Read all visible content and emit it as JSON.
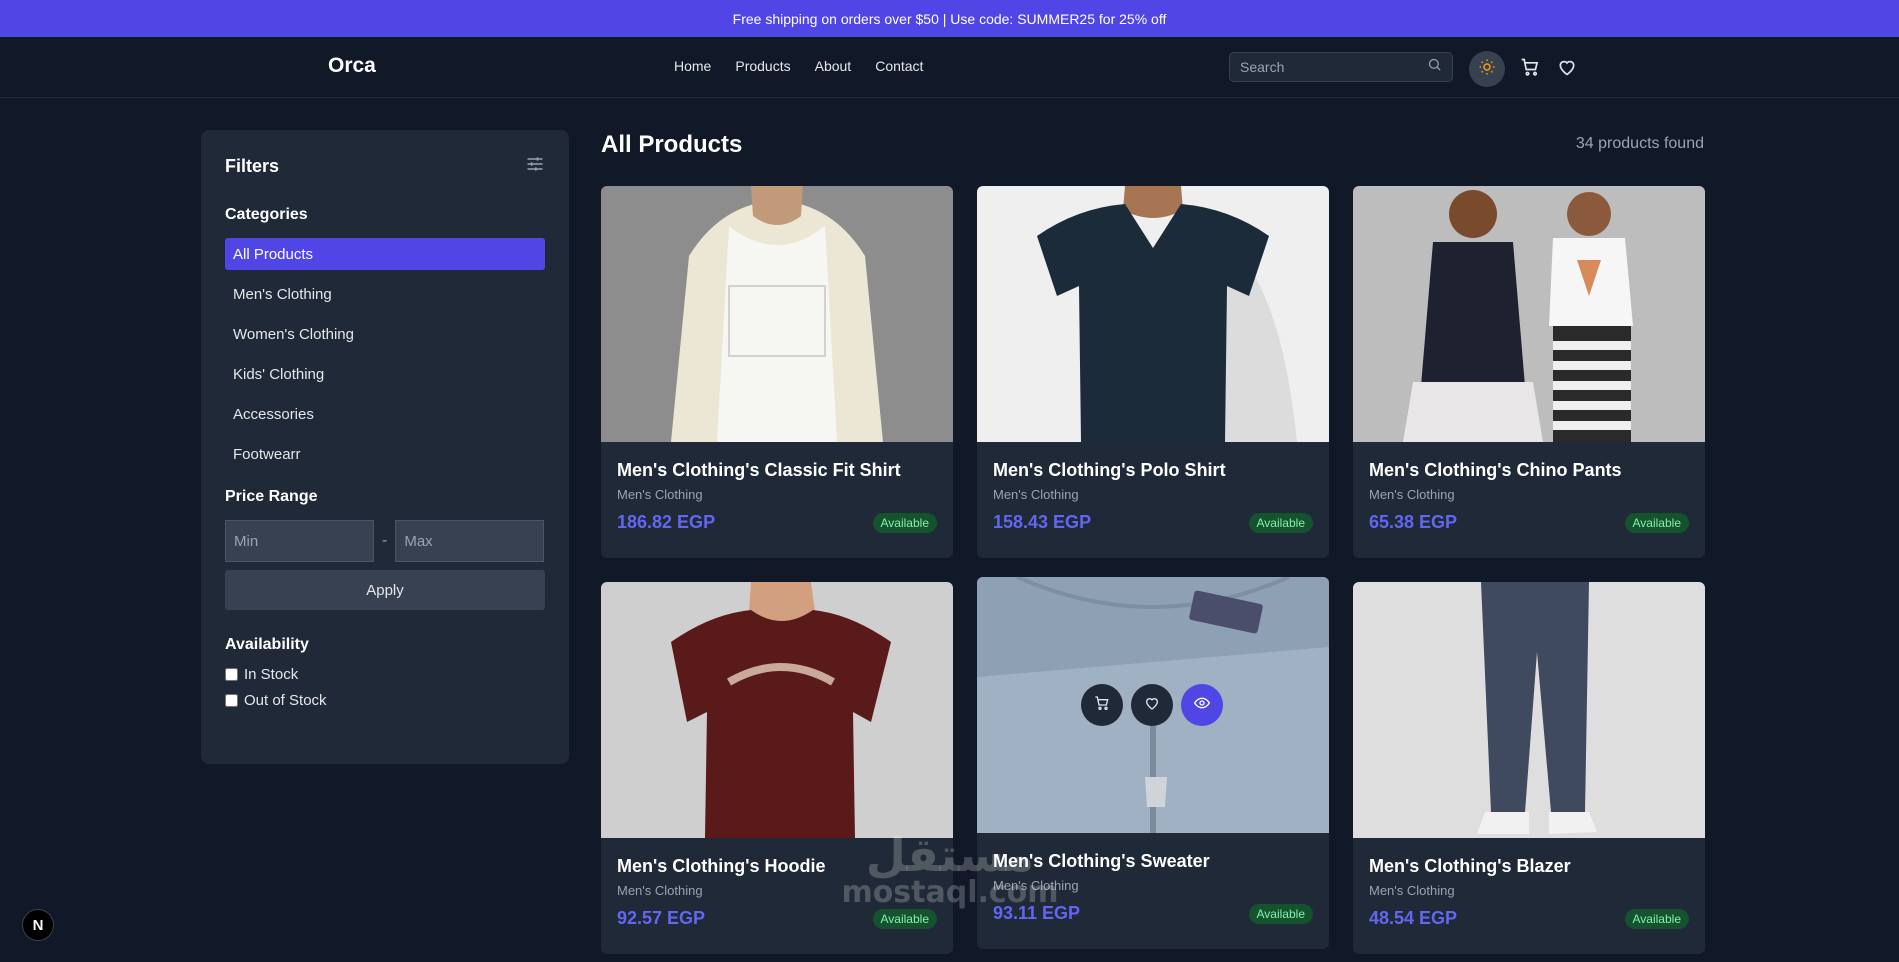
{
  "promo": "Free shipping on orders over $50 | Use code: SUMMER25 for 25% off",
  "header": {
    "logo": "Orca",
    "nav": [
      "Home",
      "Products",
      "About",
      "Contact"
    ],
    "search_placeholder": "Search",
    "icons": [
      "search-icon",
      "sun-icon",
      "cart-icon",
      "heart-icon"
    ]
  },
  "filters": {
    "title": "Filters",
    "categories_label": "Categories",
    "categories": [
      "All Products",
      "Men's Clothing",
      "Women's Clothing",
      "Kids' Clothing",
      "Accessories",
      "Footwearr"
    ],
    "selected_category": "All Products",
    "price_label": "Price Range",
    "min_placeholder": "Min",
    "max_placeholder": "Max",
    "apply": "Apply",
    "availability_label": "Availability",
    "availability": [
      "In Stock",
      "Out of Stock"
    ]
  },
  "main": {
    "title": "All Products",
    "count": "34 products found"
  },
  "products": [
    {
      "name": "Men's Clothing's Classic Fit Shirt",
      "category": "Men's Clothing",
      "price": "186.82 EGP",
      "status": "Available"
    },
    {
      "name": "Men's Clothing's Polo Shirt",
      "category": "Men's Clothing",
      "price": "158.43 EGP",
      "status": "Available"
    },
    {
      "name": "Men's Clothing's Chino Pants",
      "category": "Men's Clothing",
      "price": "65.38 EGP",
      "status": "Available"
    },
    {
      "name": "Men's Clothing's Hoodie",
      "category": "Men's Clothing",
      "price": "92.57 EGP",
      "status": "Available"
    },
    {
      "name": "Men's Clothing's Sweater",
      "category": "Men's Clothing",
      "price": "93.11 EGP",
      "status": "Available"
    },
    {
      "name": "Men's Clothing's Blazer",
      "category": "Men's Clothing",
      "price": "48.54 EGP",
      "status": "Available"
    }
  ],
  "dev_badge": "N",
  "watermark": {
    "line1": "مستقل",
    "line2": "mostaql.com"
  },
  "colors": {
    "accent": "#4f46e5",
    "background": "#111827",
    "card": "#1f2937",
    "price": "#6366f1",
    "badge_bg": "#14532d",
    "badge_text": "#86efac"
  }
}
